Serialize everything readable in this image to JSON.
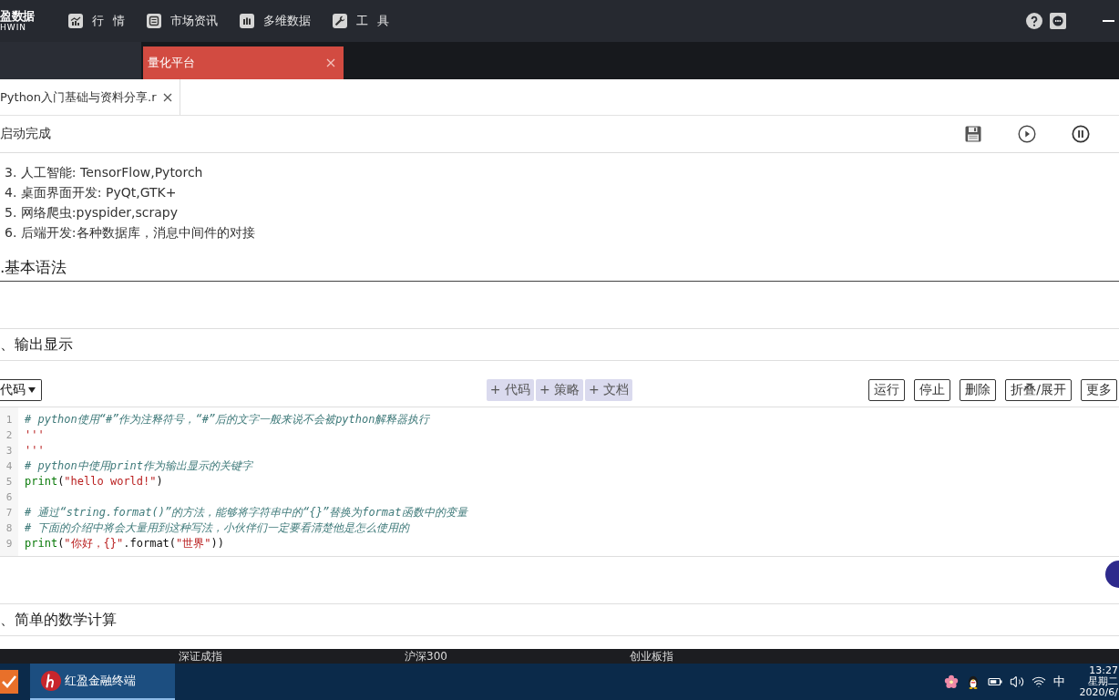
{
  "topbar": {
    "logo": {
      "title": "盈数据",
      "subtitle": "HWIN"
    },
    "menu": [
      "行 情",
      "市场资讯",
      "多维数据",
      "工 具"
    ]
  },
  "window_tabs": [
    {
      "label": "量化平台",
      "selected": true
    }
  ],
  "doc_tabs": [
    {
      "label": "Python入门基础与资料分享.r",
      "selected": true
    }
  ],
  "toolbar": {
    "status": "启动完成"
  },
  "cells": [
    {
      "kind": "list",
      "items": [
        "3. 人工智能: TensorFlow,Pytorch",
        "4. 桌面界面开发: PyQt,GTK+",
        "5. 网络爬虫:pyspider,scrapy",
        "6. 后端开发:各种数据库，消息中间件的对接"
      ]
    },
    {
      "kind": "heading",
      "text": ".基本语法"
    },
    {
      "kind": "blank"
    },
    {
      "kind": "section",
      "text": "、输出显示"
    },
    {
      "kind": "code",
      "cell_type": "代码",
      "add_buttons": [
        "+ 代码",
        "+ 策略",
        "+ 文档"
      ],
      "actions": [
        "运行",
        "停止",
        "删除",
        "折叠/展开",
        "更多"
      ],
      "lines": [
        {
          "number": "1",
          "tokens": [
            {
              "kind": "comment",
              "text": "# python使用“#”作为注释符号，“#”后的文字一般来说不会被python解释器执行"
            }
          ]
        },
        {
          "number": "2",
          "tokens": [
            {
              "kind": "string",
              "text": "'''"
            }
          ]
        },
        {
          "number": "3",
          "tokens": [
            {
              "kind": "string",
              "text": "'''"
            }
          ]
        },
        {
          "number": "4",
          "tokens": [
            {
              "kind": "comment",
              "text": "# python中使用print作为输出显示的关键字"
            }
          ]
        },
        {
          "number": "5",
          "tokens": [
            {
              "kind": "builtin",
              "text": "print"
            },
            {
              "kind": "plain",
              "text": "("
            },
            {
              "kind": "string",
              "text": "\"hello world!\""
            },
            {
              "kind": "plain",
              "text": ")"
            }
          ]
        },
        {
          "number": "6"
        },
        {
          "number": "7",
          "tokens": [
            {
              "kind": "comment",
              "text": "# 通过“string.format()”的方法，能够将字符串中的“{}”替换为format函数中的变量"
            }
          ]
        },
        {
          "number": "8",
          "tokens": [
            {
              "kind": "comment",
              "text": "# 下面的介绍中将会大量用到这种写法，小伙伴们一定要看清楚他是怎么使用的"
            }
          ]
        },
        {
          "number": "9",
          "tokens": [
            {
              "kind": "builtin",
              "text": "print"
            },
            {
              "kind": "plain",
              "text": "("
            },
            {
              "kind": "string",
              "text": "\"你好，{}\""
            },
            {
              "kind": "plain",
              "text": ".format("
            },
            {
              "kind": "string",
              "text": "\"世界\""
            },
            {
              "kind": "plain",
              "text": "))"
            }
          ]
        }
      ]
    },
    {
      "kind": "blank"
    },
    {
      "kind": "section",
      "text": "、简单的数学计算"
    }
  ],
  "ticker": [
    "深证成指",
    "沪深300",
    "创业板指"
  ],
  "taskbar": {
    "apps": [
      {
        "label": "红盈金融终端",
        "selected": true
      }
    ],
    "input_method": "中",
    "clock": {
      "time": "13:27",
      "weekday": "星期二",
      "date": "2020/6/"
    }
  }
}
